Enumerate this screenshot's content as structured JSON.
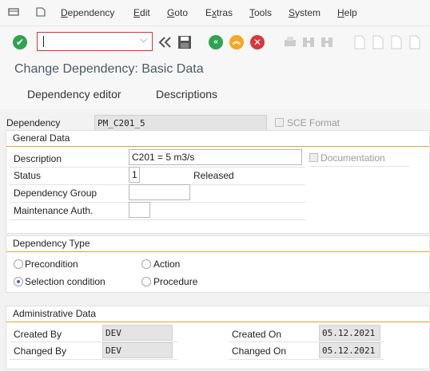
{
  "menu": {
    "items": [
      "Dependency",
      "Edit",
      "Goto",
      "Extras",
      "Tools",
      "System",
      "Help"
    ],
    "underlined": [
      "D",
      "E",
      "G",
      "x",
      "T",
      "S",
      "H"
    ]
  },
  "toolbar": {
    "command_value": "",
    "icons": [
      "enter-icon",
      "back-double-icon",
      "save-icon",
      "back-icon",
      "exit-icon",
      "cancel-icon",
      "print-icon",
      "find-icon",
      "find-next-icon",
      "first-page-icon",
      "previous-page-icon",
      "next-page-icon",
      "last-page-icon"
    ]
  },
  "page_title": "Change Dependency: Basic Data",
  "tabs": [
    "Dependency editor",
    "Descriptions"
  ],
  "dependency": {
    "label": "Dependency",
    "value": "PM_C201_5",
    "sce_label": "SCE Format"
  },
  "general": {
    "title": "General Data",
    "description_label": "Description",
    "description_value": "C201 = 5 m3/s",
    "documentation_label": "Documentation",
    "status_label": "Status",
    "status_value": "1",
    "status_text": "Released",
    "group_label": "Dependency Group",
    "group_value": "",
    "auth_label": "Maintenance Auth.",
    "auth_value": ""
  },
  "dep_type": {
    "title": "Dependency Type",
    "options": [
      "Precondition",
      "Action",
      "Selection condition",
      "Procedure"
    ],
    "selected": "Selection condition"
  },
  "admin": {
    "title": "Administrative Data",
    "created_by_label": "Created By",
    "created_by": "DEV",
    "changed_by_label": "Changed By",
    "changed_by": "DEV",
    "created_on_label": "Created On",
    "created_on": "05.12.2021",
    "changed_on_label": "Changed On",
    "changed_on": "05.12.2021"
  },
  "colors": {
    "accent": "#e8a13a",
    "enter": "#2ea44f",
    "exit": "#f5a623",
    "cancel": "#d9363e"
  }
}
